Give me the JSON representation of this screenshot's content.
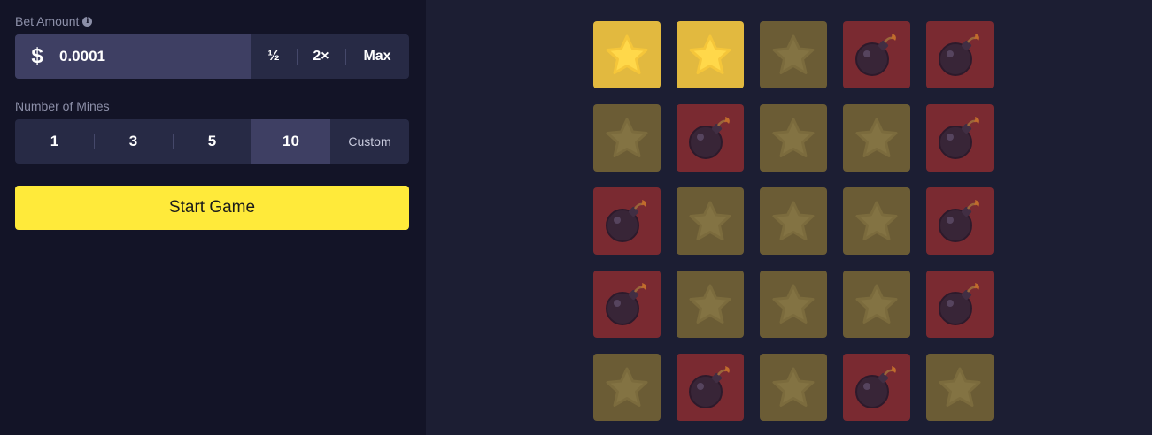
{
  "bet": {
    "label": "Bet Amount",
    "info_icon": "info-icon",
    "currency_symbol": "$",
    "value": "0.0001",
    "half_label": "½",
    "double_label": "2×",
    "max_label": "Max"
  },
  "mines": {
    "label": "Number of Mines",
    "options": [
      "1",
      "3",
      "5",
      "10"
    ],
    "selected": "10",
    "custom_label": "Custom"
  },
  "start_button": {
    "label": "Start Game"
  },
  "board": {
    "rows": 5,
    "cols": 5,
    "cells": [
      [
        "gem-revealed",
        "gem-revealed",
        "gem",
        "mine",
        "mine"
      ],
      [
        "gem",
        "mine",
        "gem",
        "gem",
        "mine"
      ],
      [
        "mine",
        "gem",
        "gem",
        "gem",
        "mine"
      ],
      [
        "mine",
        "gem",
        "gem",
        "gem",
        "mine"
      ],
      [
        "gem",
        "mine",
        "gem",
        "mine",
        "gem"
      ]
    ],
    "icons": {
      "gem": "star-icon",
      "mine": "bomb-icon"
    }
  },
  "colors": {
    "sidebar_bg": "#131427",
    "board_bg": "#1c1e33",
    "start_button": "#ffea3a",
    "tile_revealed": "#e2b93f",
    "tile_gem_dim": "#6b5c35",
    "tile_mine_dim": "#7a2a31"
  }
}
